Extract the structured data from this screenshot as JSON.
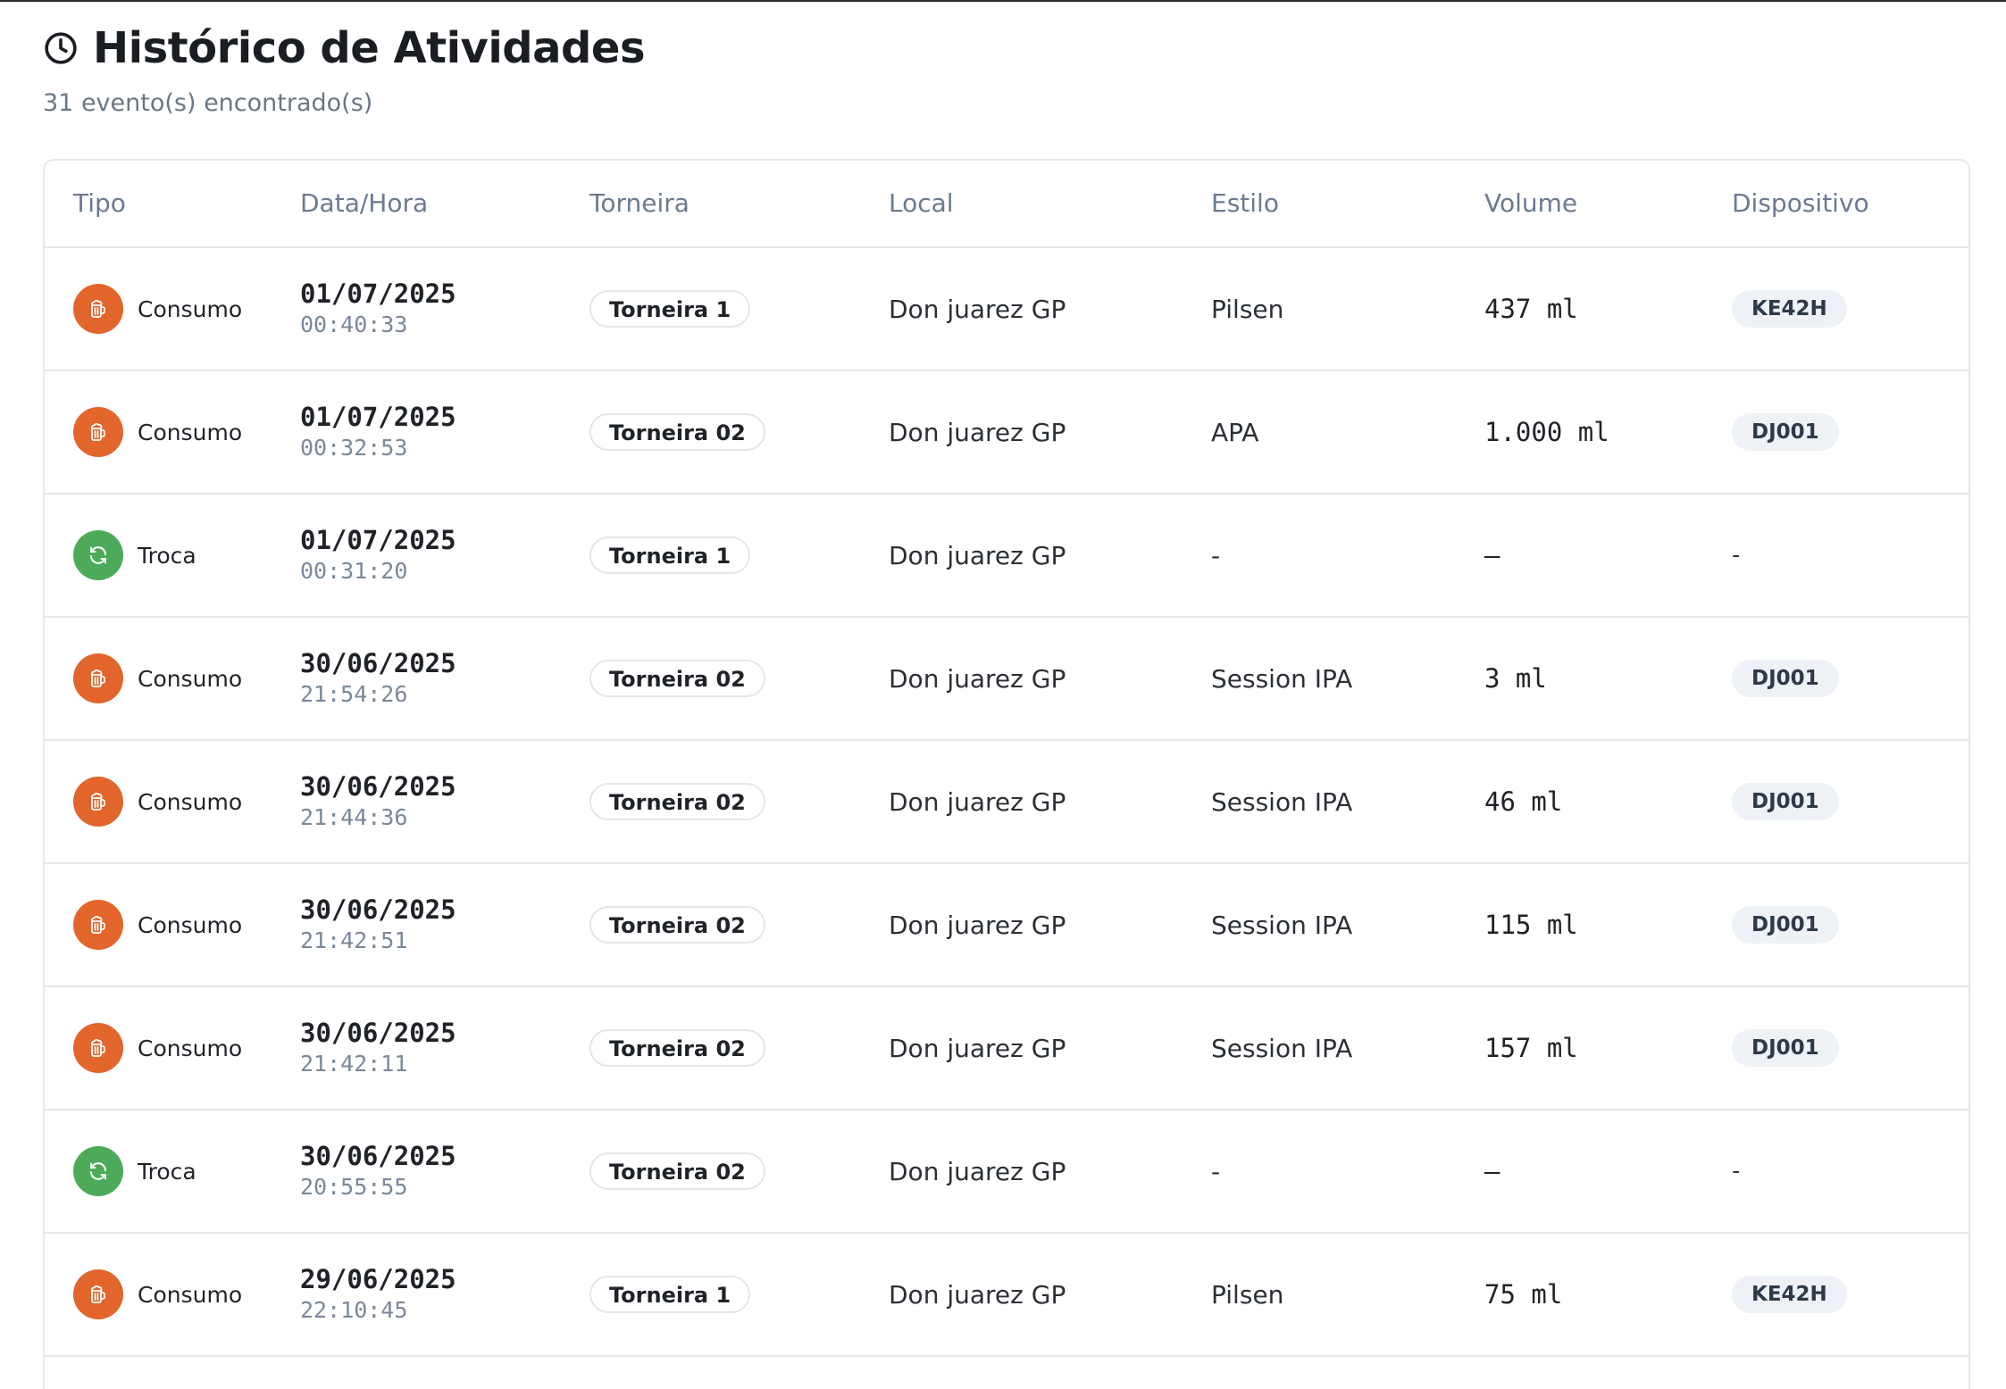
{
  "header": {
    "title": "Histórico de Atividades",
    "subtitle": "31 evento(s) encontrado(s)"
  },
  "table": {
    "columns": [
      "Tipo",
      "Data/Hora",
      "Torneira",
      "Local",
      "Estilo",
      "Volume",
      "Dispositivo"
    ],
    "rows": [
      {
        "tipo": "Consumo",
        "icon": "beer-mug-icon",
        "date": "01/07/2025",
        "time": "00:40:33",
        "torneira": "Torneira 1",
        "local": "Don juarez GP",
        "estilo": "Pilsen",
        "volume": "437 ml",
        "dispositivo": "KE42H"
      },
      {
        "tipo": "Consumo",
        "icon": "beer-mug-icon",
        "date": "01/07/2025",
        "time": "00:32:53",
        "torneira": "Torneira 02",
        "local": "Don juarez GP",
        "estilo": "APA",
        "volume": "1.000 ml",
        "dispositivo": "DJ001"
      },
      {
        "tipo": "Troca",
        "icon": "refresh-icon",
        "date": "01/07/2025",
        "time": "00:31:20",
        "torneira": "Torneira 1",
        "local": "Don juarez GP",
        "estilo": "-",
        "volume": "–",
        "dispositivo": "-"
      },
      {
        "tipo": "Consumo",
        "icon": "beer-mug-icon",
        "date": "30/06/2025",
        "time": "21:54:26",
        "torneira": "Torneira 02",
        "local": "Don juarez GP",
        "estilo": "Session IPA",
        "volume": "3 ml",
        "dispositivo": "DJ001"
      },
      {
        "tipo": "Consumo",
        "icon": "beer-mug-icon",
        "date": "30/06/2025",
        "time": "21:44:36",
        "torneira": "Torneira 02",
        "local": "Don juarez GP",
        "estilo": "Session IPA",
        "volume": "46 ml",
        "dispositivo": "DJ001"
      },
      {
        "tipo": "Consumo",
        "icon": "beer-mug-icon",
        "date": "30/06/2025",
        "time": "21:42:51",
        "torneira": "Torneira 02",
        "local": "Don juarez GP",
        "estilo": "Session IPA",
        "volume": "115 ml",
        "dispositivo": "DJ001"
      },
      {
        "tipo": "Consumo",
        "icon": "beer-mug-icon",
        "date": "30/06/2025",
        "time": "21:42:11",
        "torneira": "Torneira 02",
        "local": "Don juarez GP",
        "estilo": "Session IPA",
        "volume": "157 ml",
        "dispositivo": "DJ001"
      },
      {
        "tipo": "Troca",
        "icon": "refresh-icon",
        "date": "30/06/2025",
        "time": "20:55:55",
        "torneira": "Torneira 02",
        "local": "Don juarez GP",
        "estilo": "-",
        "volume": "–",
        "dispositivo": "-"
      },
      {
        "tipo": "Consumo",
        "icon": "beer-mug-icon",
        "date": "29/06/2025",
        "time": "22:10:45",
        "torneira": "Torneira 1",
        "local": "Don juarez GP",
        "estilo": "Pilsen",
        "volume": "75 ml",
        "dispositivo": "KE42H"
      }
    ]
  },
  "colors": {
    "consumo": "#e2652c",
    "troca": "#4caa58",
    "header_text": "#6b7a90",
    "border": "#e6e8eb",
    "device_badge_bg": "#eef1f5"
  }
}
